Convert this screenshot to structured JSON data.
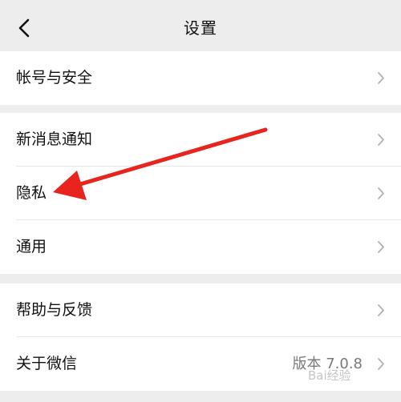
{
  "nav": {
    "title": "设置",
    "back_icon": "chevron-left-icon"
  },
  "groups": [
    {
      "items": [
        {
          "label": "帐号与安全",
          "value": ""
        }
      ]
    },
    {
      "items": [
        {
          "label": "新消息通知",
          "value": ""
        },
        {
          "label": "隐私",
          "value": ""
        },
        {
          "label": "通用",
          "value": ""
        }
      ]
    },
    {
      "items": [
        {
          "label": "帮助与反馈",
          "value": ""
        },
        {
          "label": "关于微信",
          "value": "版本 7.0.8"
        }
      ]
    }
  ],
  "annotation": {
    "type": "arrow",
    "color": "#e8241f",
    "target": "隐私"
  },
  "watermark": {
    "text": "Bai经验"
  },
  "colors": {
    "background": "#ededed",
    "cell": "#ffffff",
    "text": "#111111",
    "secondary_text": "#7a7a7a",
    "chevron": "#b2b2b2",
    "annotation_arrow": "#e8241f"
  }
}
